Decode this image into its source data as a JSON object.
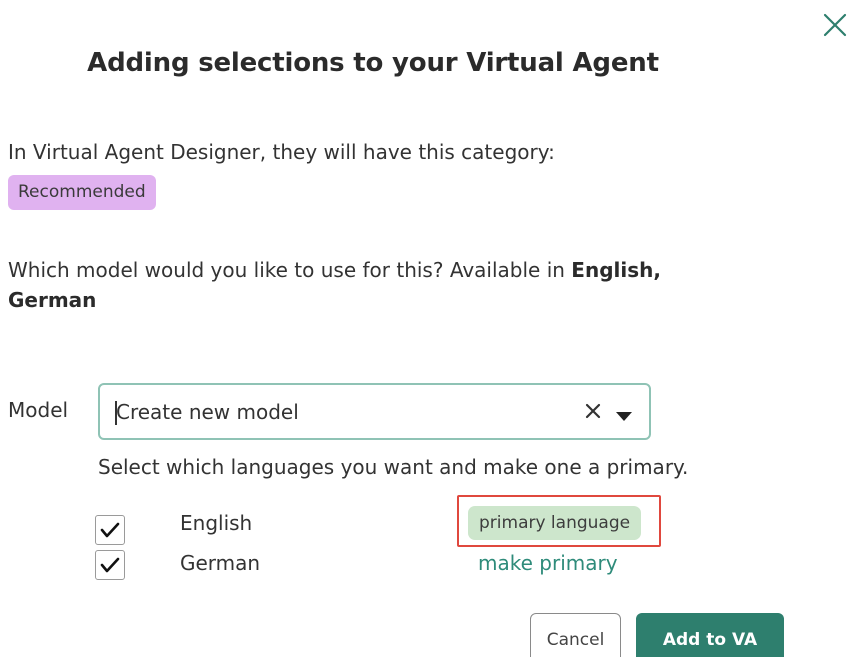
{
  "dialog": {
    "title": "Adding selections to your Virtual Agent",
    "close_icon": "close-icon"
  },
  "category": {
    "intro": "In Virtual Agent Designer, they will have this category:",
    "badge": "Recommended",
    "badge_color": "#e0b2f0"
  },
  "question": {
    "text": "Which model would you like to use for this? Available in ",
    "languages_bold": "English, German"
  },
  "model": {
    "label": "Model",
    "selected_value": "Create new model",
    "clear_icon": "close-icon",
    "dropdown_icon": "chevron-down-icon"
  },
  "languages": {
    "helper": "Select which languages you want and make one a primary.",
    "items": [
      {
        "name": "English",
        "checked": true,
        "status": "primary language"
      },
      {
        "name": "German",
        "checked": true,
        "action": "make primary"
      }
    ],
    "primary_badge_color": "#cde6cc",
    "link_color": "#2e8b7a"
  },
  "footer": {
    "cancel_label": "Cancel",
    "submit_label": "Add to VA",
    "submit_color": "#2e7f6e"
  }
}
